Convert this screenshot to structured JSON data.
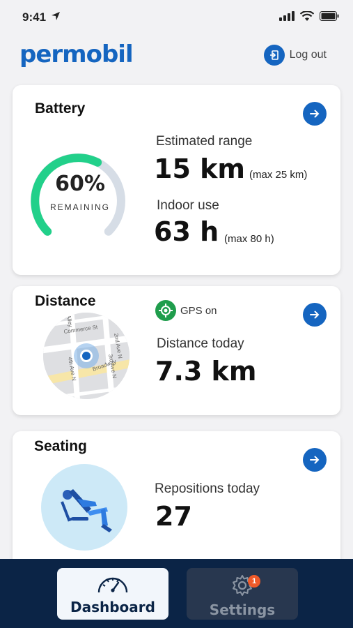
{
  "status_bar": {
    "time": "9:41"
  },
  "header": {
    "logo": "permobil",
    "logout_label": "Log out"
  },
  "battery": {
    "title": "Battery",
    "percent_label": "60%",
    "percent_value": 60,
    "remaining_label": "REMAINING",
    "range_label": "Estimated range",
    "range_value": "15 km",
    "range_max": "(max 25 km)",
    "indoor_label": "Indoor use",
    "indoor_value": "63 h",
    "indoor_max": "(max 80 h)",
    "colors": {
      "fill": "#22d08a",
      "track": "#d6dde6"
    }
  },
  "distance": {
    "title": "Distance",
    "gps_label": "GPS on",
    "today_label": "Distance today",
    "today_value": "7.3 km",
    "map_streets": [
      "Commerce St",
      "2nd Ave N",
      "3rd Ave N",
      "4th Ave N",
      "Broadway",
      "Alley",
      "way"
    ]
  },
  "seating": {
    "title": "Seating",
    "repositions_label": "Repositions today",
    "repositions_value": "27"
  },
  "tabbar": {
    "tabs": [
      {
        "label": "Dashboard",
        "icon": "speedometer-icon",
        "active": true
      },
      {
        "label": "Settings",
        "icon": "gear-icon",
        "active": false,
        "badge": "1"
      }
    ]
  },
  "colors": {
    "brand": "#1565c0",
    "tabbar": "#0b2446",
    "gps": "#1f9d4c",
    "badge": "#ef5a2a"
  }
}
